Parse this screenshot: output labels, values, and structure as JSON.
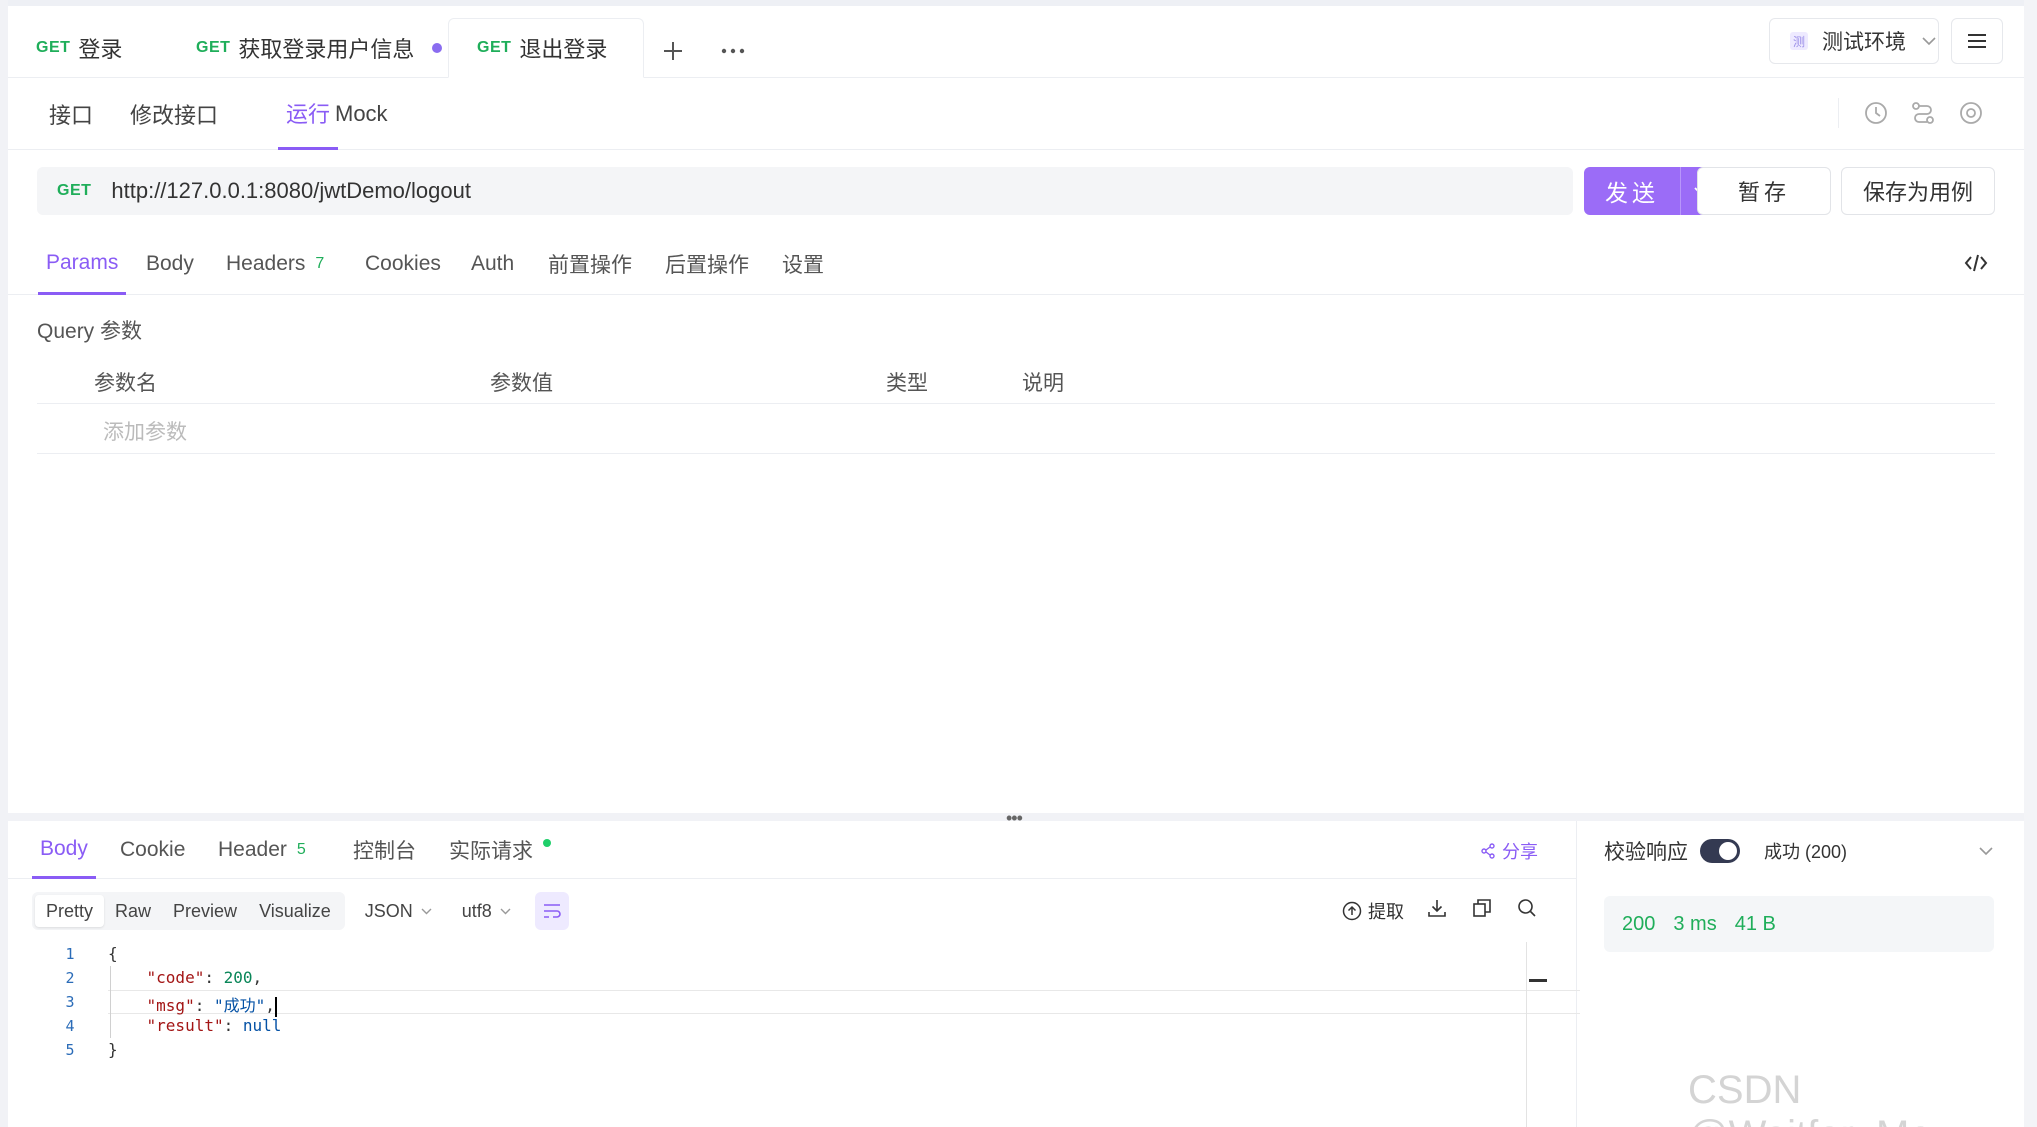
{
  "tabs": [
    {
      "method": "GET",
      "label": "登录"
    },
    {
      "method": "GET",
      "label": "获取登录用户信息",
      "unsaved": true
    },
    {
      "method": "GET",
      "label": "退出登录",
      "active": true
    }
  ],
  "env": {
    "badge": "测",
    "label": "测试环境"
  },
  "subnav": [
    "接口",
    "修改接口",
    "运行",
    "Mock"
  ],
  "request": {
    "method": "GET",
    "url": "http://127.0.0.1:8080/jwtDemo/logout",
    "send_label": "发送",
    "save_label": "暂存",
    "save_case_label": "保存为用例"
  },
  "param_tabs": {
    "params": "Params",
    "body": "Body",
    "headers": "Headers",
    "headers_count": "7",
    "cookies": "Cookies",
    "auth": "Auth",
    "pre": "前置操作",
    "post": "后置操作",
    "settings": "设置"
  },
  "query": {
    "title": "Query 参数",
    "columns": [
      "参数名",
      "参数值",
      "类型",
      "说明"
    ],
    "placeholder": "添加参数"
  },
  "response_tabs": {
    "body": "Body",
    "cookie": "Cookie",
    "header": "Header",
    "header_count": "5",
    "console": "控制台",
    "actual": "实际请求",
    "share": "分享"
  },
  "format": {
    "modes": [
      "Pretty",
      "Raw",
      "Preview",
      "Visualize"
    ],
    "lang": "JSON",
    "encoding": "utf8",
    "extract": "提取"
  },
  "code": {
    "line_numbers": [
      "1",
      "2",
      "3",
      "4",
      "5"
    ],
    "brace_open": "{",
    "brace_close": "}",
    "code_key": "\"code\"",
    "code_val": "200",
    "msg_key": "\"msg\"",
    "msg_val": "\"成功\"",
    "result_key": "\"result\"",
    "result_val": "null"
  },
  "validate": {
    "label": "校验响应",
    "status": "成功 (200)",
    "code": "200",
    "time": "3 ms",
    "size": "41 B"
  },
  "watermark": "CSDN @Waitfor_Me"
}
